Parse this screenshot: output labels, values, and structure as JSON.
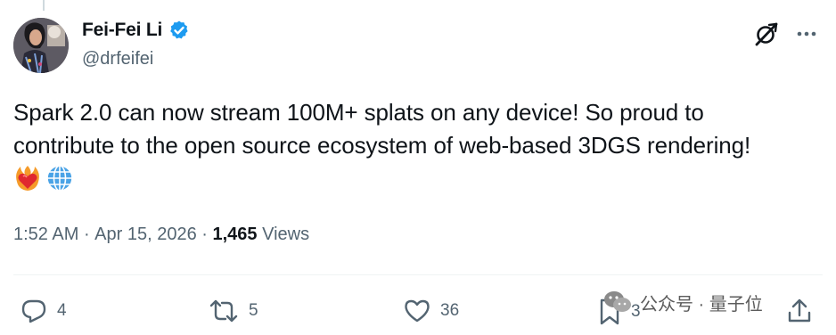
{
  "tweet": {
    "author": {
      "display_name": "Fei-Fei Li",
      "handle": "@drfeifei",
      "verified": true,
      "avatar_icon": "profile-photo"
    },
    "text_line1": "Spark 2.0 can now stream 100M+ splats on any device! So proud to",
    "text_line2": "contribute to the open source ecosystem of web-based 3DGS rendering!",
    "emojis": [
      "heart-on-fire-emoji",
      "globe-with-meridians-emoji"
    ],
    "time": "1:52 AM",
    "separator": " · ",
    "date": "Apr 15, 2026",
    "views_count": "1,465",
    "views_label": " Views"
  },
  "actions": {
    "replies": "4",
    "reposts": "5",
    "likes": "36",
    "bookmarks": "3"
  },
  "top_icons": [
    "grok-icon",
    "more-icon"
  ],
  "watermark": {
    "text": "公众号 · 量子位"
  },
  "colors": {
    "text": "#0f1419",
    "secondary": "#536471",
    "verified": "#1d9bf0",
    "divider": "#eff3f4"
  }
}
